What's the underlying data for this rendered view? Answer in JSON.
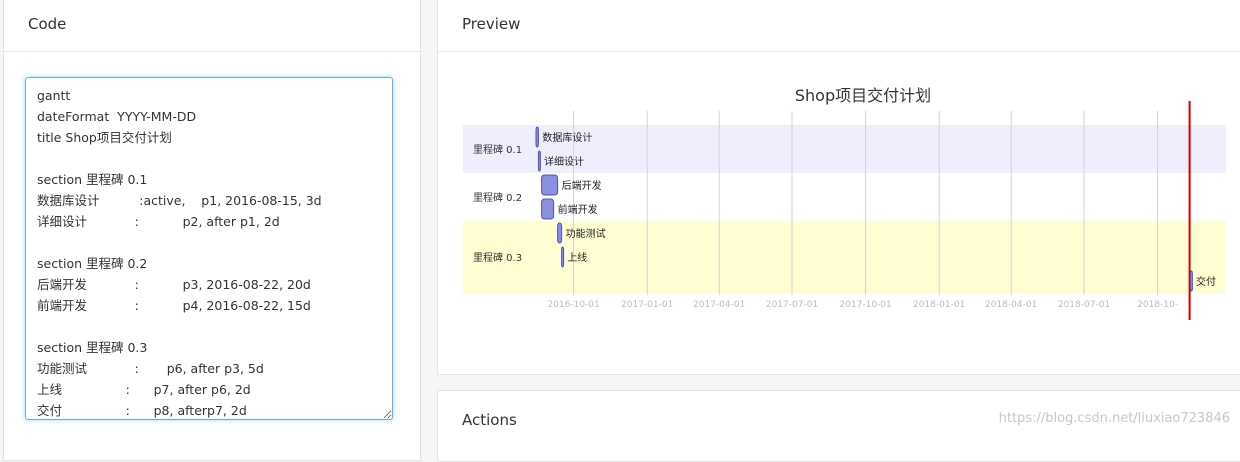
{
  "code_panel": {
    "title": "Code",
    "code": "gantt\ndateFormat  YYYY-MM-DD\ntitle Shop项目交付计划\n\nsection 里程碑 0.1\n数据库设计          :active,    p1, 2016-08-15, 3d\n详细设计            :           p2, after p1, 2d\n\nsection 里程碑 0.2\n后端开发            :           p3, 2016-08-22, 20d\n前端开发            :           p4, 2016-08-22, 15d\n\nsection 里程碑 0.3\n功能测试            :       p6, after p3, 5d\n上线                :      p7, after p6, 2d\n交付                :      p8, afterp7, 2d"
  },
  "preview_panel": {
    "title": "Preview"
  },
  "actions_panel": {
    "title": "Actions"
  },
  "watermark": "https://blog.csdn.net/liuxiao723846",
  "chart_data": {
    "type": "gantt",
    "title": "Shop项目交付计划",
    "sections": [
      {
        "name": "里程碑 0.1",
        "color": "#eeeefd"
      },
      {
        "name": "里程碑 0.2",
        "color": "#ffffff"
      },
      {
        "name": "里程碑 0.3",
        "color": "#fefed2"
      }
    ],
    "tasks": [
      {
        "name": "数据库设计",
        "section": 0,
        "start": "2016-08-15",
        "end": "2016-08-18"
      },
      {
        "name": "详细设计",
        "section": 0,
        "start": "2016-08-18",
        "end": "2016-08-20"
      },
      {
        "name": "后端开发",
        "section": 1,
        "start": "2016-08-22",
        "end": "2016-09-11"
      },
      {
        "name": "前端开发",
        "section": 1,
        "start": "2016-08-22",
        "end": "2016-09-06"
      },
      {
        "name": "功能测试",
        "section": 2,
        "start": "2016-09-11",
        "end": "2016-09-16"
      },
      {
        "name": "上线",
        "section": 2,
        "start": "2016-09-16",
        "end": "2016-09-18"
      },
      {
        "name": "交付",
        "section": 2,
        "start": "2018-11-11",
        "end": "2018-11-13"
      }
    ],
    "x_ticks": [
      "2016-10-01",
      "2017-01-01",
      "2017-04-01",
      "2017-07-01",
      "2017-10-01",
      "2018-01-01",
      "2018-04-01",
      "2018-07-01",
      "2018-10-01"
    ],
    "x_tick_labels": [
      "2016-10-01",
      "2017-01-01",
      "2017-04-01",
      "2017-07-01",
      "2017-10-01",
      "2018-01-01",
      "2018-04-01",
      "2018-07-01",
      "2018-10-"
    ],
    "today_marker": "2018-11-10",
    "colors": {
      "task_fill": "#8a90dd",
      "task_stroke": "#534fbc",
      "today_line": "#cc0000",
      "grid": "#d3d3d3"
    }
  }
}
